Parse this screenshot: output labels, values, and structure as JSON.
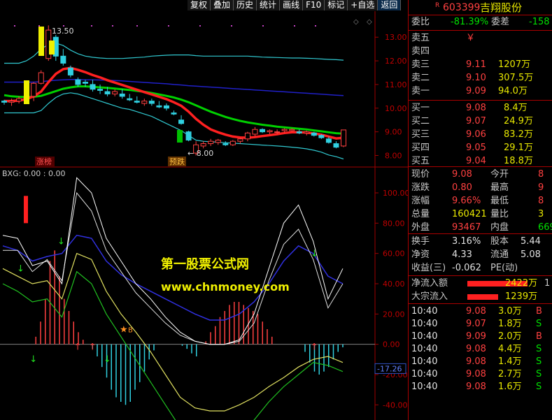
{
  "toolbar": [
    {
      "label": "复权"
    },
    {
      "label": "叠加"
    },
    {
      "label": "历史"
    },
    {
      "label": "统计"
    },
    {
      "label": "画线"
    },
    {
      "label": "F10"
    },
    {
      "label": "标记"
    },
    {
      "label": "+自选"
    },
    {
      "label": "返回"
    }
  ],
  "stock": {
    "marker": "R",
    "code": "603399",
    "name": "吉翔股份"
  },
  "weibi": {
    "label": "委比",
    "value": "-81.39%",
    "label2": "委差",
    "value2": "-158"
  },
  "asks": [
    {
      "label": "卖五",
      "price": "￥",
      "vol": ""
    },
    {
      "label": "卖四",
      "price": "",
      "vol": ""
    },
    {
      "label": "卖三",
      "price": "9.11",
      "vol": "1207万"
    },
    {
      "label": "卖二",
      "price": "9.10",
      "vol": "307.5万"
    },
    {
      "label": "卖一",
      "price": "9.09",
      "vol": "94.0万"
    }
  ],
  "bids": [
    {
      "label": "买一",
      "price": "9.08",
      "vol": "8.4万"
    },
    {
      "label": "买二",
      "price": "9.07",
      "vol": "24.9万"
    },
    {
      "label": "买三",
      "price": "9.06",
      "vol": "83.2万"
    },
    {
      "label": "买四",
      "price": "9.05",
      "vol": "29.1万"
    },
    {
      "label": "买五",
      "price": "9.04",
      "vol": "18.8万"
    }
  ],
  "quote": [
    {
      "l1": "现价",
      "v1": "9.08",
      "l2": "今开",
      "v2": "8"
    },
    {
      "l1": "涨跌",
      "v1": "0.80",
      "l2": "最高",
      "v2": "9"
    },
    {
      "l1": "涨幅",
      "v1": "9.66%",
      "l2": "最低",
      "v2": "8"
    },
    {
      "l1": "总量",
      "v1": "160421",
      "l2": "量比",
      "v2": "3"
    },
    {
      "l1": "外盘",
      "v1": "93467",
      "l2": "内盘",
      "v2": "669"
    }
  ],
  "fund": [
    {
      "l1": "换手",
      "v1": "3.16%",
      "l2": "股本",
      "v2": "5.44"
    },
    {
      "l1": "净资",
      "v1": "4.33",
      "l2": "流通",
      "v2": "5.08"
    },
    {
      "l1": "收益(三)",
      "v1": "-0.062",
      "l2": "PE(动)",
      "v2": ""
    }
  ],
  "flow": [
    {
      "label": "净流入额",
      "value": "2422万",
      "extra": "1"
    },
    {
      "label": "大宗流入",
      "value": "1239万",
      "extra": ""
    }
  ],
  "ticks": [
    {
      "time": "10:40",
      "price": "9.08",
      "vol": "3.0万",
      "side": "B"
    },
    {
      "time": "10:40",
      "price": "9.07",
      "vol": "1.8万",
      "side": "S"
    },
    {
      "time": "10:40",
      "price": "9.09",
      "vol": "2.0万",
      "side": "B"
    },
    {
      "time": "10:40",
      "price": "9.08",
      "vol": "4.4万",
      "side": "S"
    },
    {
      "time": "10:40",
      "price": "9.08",
      "vol": "1.4万",
      "side": "S"
    },
    {
      "time": "10:40",
      "price": "9.08",
      "vol": "2.7万",
      "side": "S"
    },
    {
      "time": "10:40",
      "price": "9.08",
      "vol": "1.6万",
      "side": "S"
    }
  ],
  "colors": {
    "up": "#ff4040",
    "down": "#00e000",
    "label": "#e8e800",
    "axis": "#a00000",
    "ma_red": "#ff2020",
    "ma_green": "#00d000",
    "boll_blue": "#2020c8",
    "boll_cyan": "#30c8d0"
  },
  "chart_data": [
    {
      "type": "candlestick",
      "ylim": [
        7.6,
        14.1
      ],
      "yticks": [
        "13.00",
        "12.00",
        "11.00",
        "10.00",
        "9.00",
        "8.00"
      ],
      "ytick_values": [
        13,
        12,
        11,
        10,
        9,
        8
      ],
      "annotations": {
        "high": "13.50",
        "low": "← 8.00",
        "tag1": "涨榜",
        "tag2": "预跌"
      },
      "candles": [
        {
          "o": 10.3,
          "h": 10.35,
          "l": 10.15,
          "c": 10.25
        },
        {
          "o": 10.25,
          "h": 10.4,
          "l": 10.1,
          "c": 10.3
        },
        {
          "o": 10.3,
          "h": 10.5,
          "l": 10.2,
          "c": 10.4
        },
        {
          "o": 10.4,
          "h": 10.6,
          "l": 10.3,
          "c": 10.5
        },
        {
          "o": 10.5,
          "h": 11.1,
          "l": 10.3,
          "c": 11.05
        },
        {
          "o": 11.05,
          "h": 11.6,
          "l": 11.0,
          "c": 11.5
        },
        {
          "o": 12.1,
          "h": 13.5,
          "l": 12.0,
          "c": 13.3
        },
        {
          "o": 13.0,
          "h": 13.1,
          "l": 12.0,
          "c": 12.2
        },
        {
          "o": 12.2,
          "h": 12.5,
          "l": 11.8,
          "c": 11.9
        },
        {
          "o": 11.7,
          "h": 11.8,
          "l": 11.3,
          "c": 11.4
        },
        {
          "o": 11.2,
          "h": 11.3,
          "l": 10.9,
          "c": 11.0
        },
        {
          "o": 11.1,
          "h": 11.2,
          "l": 10.9,
          "c": 11.05
        },
        {
          "o": 11.0,
          "h": 11.2,
          "l": 10.7,
          "c": 10.8
        },
        {
          "o": 10.8,
          "h": 11.0,
          "l": 10.6,
          "c": 10.75
        },
        {
          "o": 10.7,
          "h": 10.9,
          "l": 10.5,
          "c": 10.6
        },
        {
          "o": 10.6,
          "h": 10.8,
          "l": 10.5,
          "c": 10.7
        },
        {
          "o": 10.6,
          "h": 10.8,
          "l": 10.4,
          "c": 10.5
        },
        {
          "o": 10.4,
          "h": 10.6,
          "l": 10.3,
          "c": 10.35
        },
        {
          "o": 10.3,
          "h": 10.5,
          "l": 10.2,
          "c": 10.25
        },
        {
          "o": 10.2,
          "h": 10.4,
          "l": 10.1,
          "c": 10.3
        },
        {
          "o": 10.3,
          "h": 10.4,
          "l": 10.1,
          "c": 10.2
        },
        {
          "o": 10.1,
          "h": 10.3,
          "l": 10.0,
          "c": 10.05
        },
        {
          "o": 10.1,
          "h": 10.2,
          "l": 9.9,
          "c": 10.0
        },
        {
          "o": 9.8,
          "h": 9.9,
          "l": 9.7,
          "c": 9.75
        },
        {
          "o": 9.5,
          "h": 9.7,
          "l": 9.3,
          "c": 9.35
        },
        {
          "o": 9.0,
          "h": 9.05,
          "l": 8.6,
          "c": 8.65
        },
        {
          "o": 8.1,
          "h": 8.6,
          "l": 8.0,
          "c": 8.45
        },
        {
          "o": 8.4,
          "h": 8.6,
          "l": 8.3,
          "c": 8.5
        },
        {
          "o": 8.5,
          "h": 8.7,
          "l": 8.4,
          "c": 8.6
        },
        {
          "o": 8.55,
          "h": 8.7,
          "l": 8.45,
          "c": 8.65
        },
        {
          "o": 8.5,
          "h": 8.6,
          "l": 8.4,
          "c": 8.45
        },
        {
          "o": 8.45,
          "h": 8.65,
          "l": 8.4,
          "c": 8.6
        },
        {
          "o": 8.6,
          "h": 8.75,
          "l": 8.5,
          "c": 8.7
        },
        {
          "o": 8.7,
          "h": 9.0,
          "l": 8.6,
          "c": 8.95
        },
        {
          "o": 8.9,
          "h": 9.2,
          "l": 8.8,
          "c": 9.1
        },
        {
          "o": 9.1,
          "h": 9.15,
          "l": 8.95,
          "c": 9.0
        },
        {
          "o": 9.0,
          "h": 9.1,
          "l": 8.9,
          "c": 9.05
        },
        {
          "o": 9.0,
          "h": 9.1,
          "l": 8.9,
          "c": 9.0
        },
        {
          "o": 9.05,
          "h": 9.15,
          "l": 8.95,
          "c": 9.1
        },
        {
          "o": 9.05,
          "h": 9.15,
          "l": 9.0,
          "c": 9.1
        },
        {
          "o": 9.0,
          "h": 9.1,
          "l": 8.9,
          "c": 8.95
        },
        {
          "o": 8.95,
          "h": 9.05,
          "l": 8.85,
          "c": 9.0
        },
        {
          "o": 8.95,
          "h": 9.0,
          "l": 8.8,
          "c": 8.85
        },
        {
          "o": 8.85,
          "h": 8.9,
          "l": 8.7,
          "c": 8.75
        },
        {
          "o": 8.7,
          "h": 8.8,
          "l": 8.5,
          "c": 8.55
        },
        {
          "o": 8.5,
          "h": 8.6,
          "l": 8.3,
          "c": 8.35
        },
        {
          "o": 8.4,
          "h": 9.08,
          "l": 8.35,
          "c": 9.08
        }
      ],
      "ma_red": [
        10.3,
        10.3,
        10.32,
        10.38,
        10.5,
        10.7,
        11.1,
        11.45,
        11.65,
        11.7,
        11.62,
        11.52,
        11.4,
        11.3,
        11.18,
        11.08,
        10.98,
        10.88,
        10.78,
        10.68,
        10.58,
        10.48,
        10.38,
        10.25,
        10.1,
        9.85,
        9.55,
        9.3,
        9.1,
        8.98,
        8.88,
        8.8,
        8.76,
        8.75,
        8.78,
        8.82,
        8.86,
        8.9,
        8.95,
        8.98,
        8.98,
        8.97,
        8.93,
        8.88,
        8.8,
        8.72,
        8.75
      ],
      "ma_green": [
        10.55,
        10.5,
        10.48,
        10.47,
        10.48,
        10.52,
        10.62,
        10.72,
        10.82,
        10.88,
        10.92,
        10.92,
        10.9,
        10.88,
        10.86,
        10.83,
        10.8,
        10.77,
        10.73,
        10.69,
        10.64,
        10.58,
        10.52,
        10.45,
        10.36,
        10.25,
        10.12,
        9.98,
        9.85,
        9.74,
        9.63,
        9.54,
        9.46,
        9.4,
        9.35,
        9.3,
        9.26,
        9.22,
        9.19,
        9.16,
        9.13,
        9.1,
        9.06,
        9.02,
        8.98,
        8.94,
        8.92
      ],
      "boll_blue": [
        11.1,
        11.1,
        11.1,
        11.1,
        11.1,
        11.12,
        11.15,
        11.18,
        11.2,
        11.21,
        11.21,
        11.2,
        11.2,
        11.19,
        11.18,
        11.17,
        11.15,
        11.13,
        11.11,
        11.09,
        11.07,
        11.05,
        11.03,
        11.0,
        10.98,
        10.95,
        10.93,
        10.91,
        10.89,
        10.87,
        10.85,
        10.83,
        10.81,
        10.79,
        10.77,
        10.75,
        10.73,
        10.71,
        10.69,
        10.67,
        10.65,
        10.63,
        10.61,
        10.59,
        10.57,
        10.55,
        10.53
      ],
      "boll_cyan_up": [
        11.9,
        11.9,
        11.9,
        12.0,
        12.2,
        12.5,
        12.7,
        12.75,
        12.65,
        12.45,
        12.3,
        12.2,
        12.15,
        12.12,
        12.1,
        12.1,
        12.1,
        12.12,
        12.14,
        12.16,
        12.2,
        12.22,
        12.24,
        12.25,
        12.25,
        12.25,
        12.22,
        12.2,
        12.2,
        12.2,
        12.2,
        12.2,
        12.2,
        12.2,
        12.18,
        12.16,
        12.15,
        12.14,
        12.13,
        12.12,
        12.12,
        12.11,
        12.1,
        12.08,
        12.06,
        12.05,
        12.03
      ],
      "boll_cyan_lo": [
        9.8,
        9.8,
        9.8,
        9.8,
        9.8,
        9.9,
        10.2,
        10.45,
        10.6,
        10.65,
        10.6,
        10.5,
        10.4,
        10.3,
        10.2,
        10.1,
        10.0,
        9.95,
        9.85,
        9.75,
        9.65,
        9.5,
        9.35,
        9.2,
        9.05,
        8.85,
        8.65,
        8.6,
        8.58,
        8.56,
        8.54,
        8.52,
        8.5,
        8.48,
        8.46,
        8.44,
        8.42,
        8.4,
        8.38,
        8.35,
        8.32,
        8.28,
        8.22,
        8.14,
        8.02,
        7.95,
        7.85
      ]
    },
    {
      "type": "line",
      "title": "BXG: 0.00  : 0.00",
      "ylim": [
        -50,
        112
      ],
      "yticks": [
        "100.00",
        "80.00",
        "60.00",
        "40.00",
        "20.00",
        "0.00",
        "-20.00",
        "-40.00"
      ],
      "ytick_values": [
        100,
        80,
        60,
        40,
        20,
        0,
        -20,
        -40
      ],
      "current_value": "-17.26",
      "watermark": [
        "第一股票公式网",
        "www.chnmoney.com"
      ],
      "x": [
        0,
        2,
        4,
        6,
        8,
        10,
        12,
        14,
        16,
        18,
        20,
        22,
        24,
        26,
        28,
        30,
        32,
        34,
        36,
        38,
        40,
        42,
        44,
        46
      ],
      "white_thin": [
        72,
        70,
        52,
        55,
        40,
        110,
        100,
        70,
        55,
        40,
        30,
        18,
        8,
        2,
        0,
        0,
        3,
        20,
        50,
        80,
        92,
        68,
        30,
        50
      ],
      "white_mid": [
        62,
        62,
        48,
        56,
        42,
        100,
        88,
        62,
        48,
        34,
        24,
        14,
        6,
        2,
        0,
        0,
        2,
        14,
        42,
        66,
        76,
        56,
        24,
        40
      ],
      "blue": [
        65,
        62,
        55,
        58,
        60,
        72,
        70,
        55,
        46,
        40,
        35,
        30,
        25,
        20,
        16,
        16,
        20,
        28,
        40,
        55,
        65,
        60,
        45,
        40
      ],
      "yellow": [
        50,
        45,
        40,
        42,
        30,
        60,
        56,
        35,
        20,
        8,
        -5,
        -20,
        -35,
        -42,
        -44,
        -44,
        -40,
        -35,
        -28,
        -22,
        -15,
        -10,
        -8,
        -12
      ],
      "green": [
        40,
        35,
        28,
        30,
        18,
        48,
        40,
        20,
        5,
        -10,
        -25,
        -40,
        -55,
        -60,
        -62,
        -62,
        -58,
        -50,
        -38,
        -28,
        -20,
        -12,
        -14,
        -18
      ],
      "histogram": [
        0,
        0,
        0,
        0,
        0,
        0,
        0,
        5,
        15,
        30,
        55,
        62,
        45,
        30,
        22,
        15,
        8,
        3,
        0,
        -3,
        -8,
        -15,
        -22,
        -30,
        -35,
        -38,
        -40,
        -38,
        -30,
        -25,
        -18,
        -10,
        -4,
        0,
        0,
        0,
        0,
        0,
        -1,
        -3,
        -6,
        -8,
        0,
        2,
        8,
        12,
        18,
        22,
        26,
        28,
        28,
        26,
        24,
        22,
        20,
        15,
        10,
        5,
        0,
        0,
        0,
        0,
        0,
        0,
        -5,
        -12,
        -18,
        -20,
        -18,
        -15,
        -10,
        -5,
        -2
      ],
      "hist_x_start": 0,
      "markers": {
        "up": [
          5,
          6,
          21,
          40,
          46
        ],
        "down": [
          2,
          7,
          40,
          46
        ],
        "star": [
          8,
          47
        ],
        "star_label": "B"
      }
    }
  ]
}
